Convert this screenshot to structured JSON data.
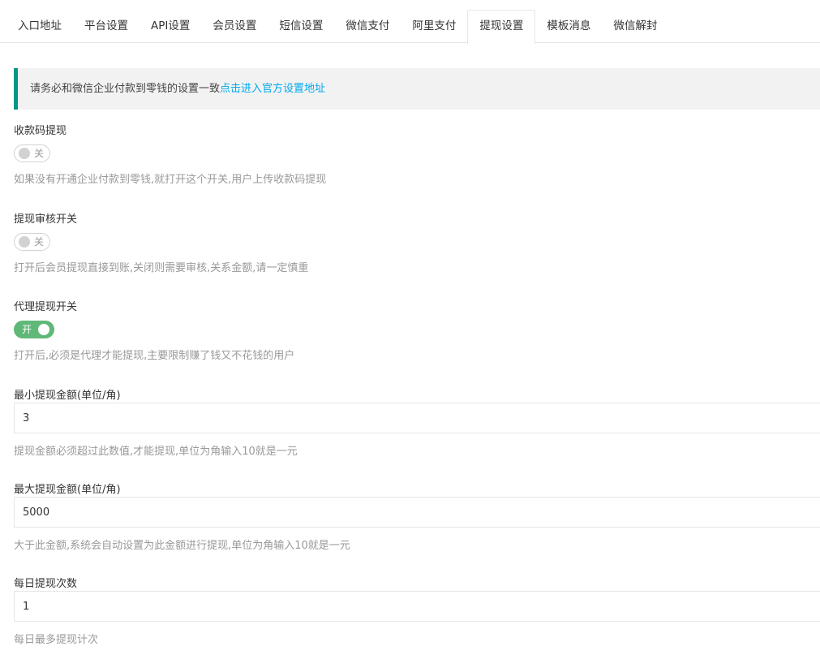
{
  "tabs": [
    {
      "label": "入口地址",
      "active": false
    },
    {
      "label": "平台设置",
      "active": false
    },
    {
      "label": "API设置",
      "active": false
    },
    {
      "label": "会员设置",
      "active": false
    },
    {
      "label": "短信设置",
      "active": false
    },
    {
      "label": "微信支付",
      "active": false
    },
    {
      "label": "阿里支付",
      "active": false
    },
    {
      "label": "提现设置",
      "active": true
    },
    {
      "label": "模板消息",
      "active": false
    },
    {
      "label": "微信解封",
      "active": false
    }
  ],
  "notice": {
    "text": "请务必和微信企业付款到零钱的设置一致",
    "link": "点击进入官方设置地址"
  },
  "fields": {
    "qrcode_withdraw": {
      "label": "收款码提现",
      "switch_text": "关",
      "enabled": false,
      "hint": "如果没有开通企业付款到零钱,就打开这个开关,用户上传收款码提现"
    },
    "withdraw_review": {
      "label": "提现审核开关",
      "switch_text": "关",
      "enabled": false,
      "hint": "打开后会员提现直接到账,关闭则需要审核,关系金额,请一定慎重"
    },
    "agent_withdraw": {
      "label": "代理提现开关",
      "switch_text": "开",
      "enabled": true,
      "hint": "打开后,必须是代理才能提现,主要限制赚了钱又不花钱的用户"
    },
    "min_amount": {
      "label": "最小提现金额(单位/角)",
      "value": "3",
      "hint": "提现金额必须超过此数值,才能提现,单位为角输入10就是一元"
    },
    "max_amount": {
      "label": "最大提现金额(单位/角)",
      "value": "5000",
      "hint": "大于此金额,系统会自动设置为此金额进行提现,单位为角输入10就是一元"
    },
    "daily_count": {
      "label": "每日提现次数",
      "value": "1",
      "hint": "每日最多提现计次"
    }
  },
  "colors": {
    "accent": "#009688",
    "link": "#01aaed",
    "switch_on": "#5fb878",
    "hint": "#999999"
  }
}
